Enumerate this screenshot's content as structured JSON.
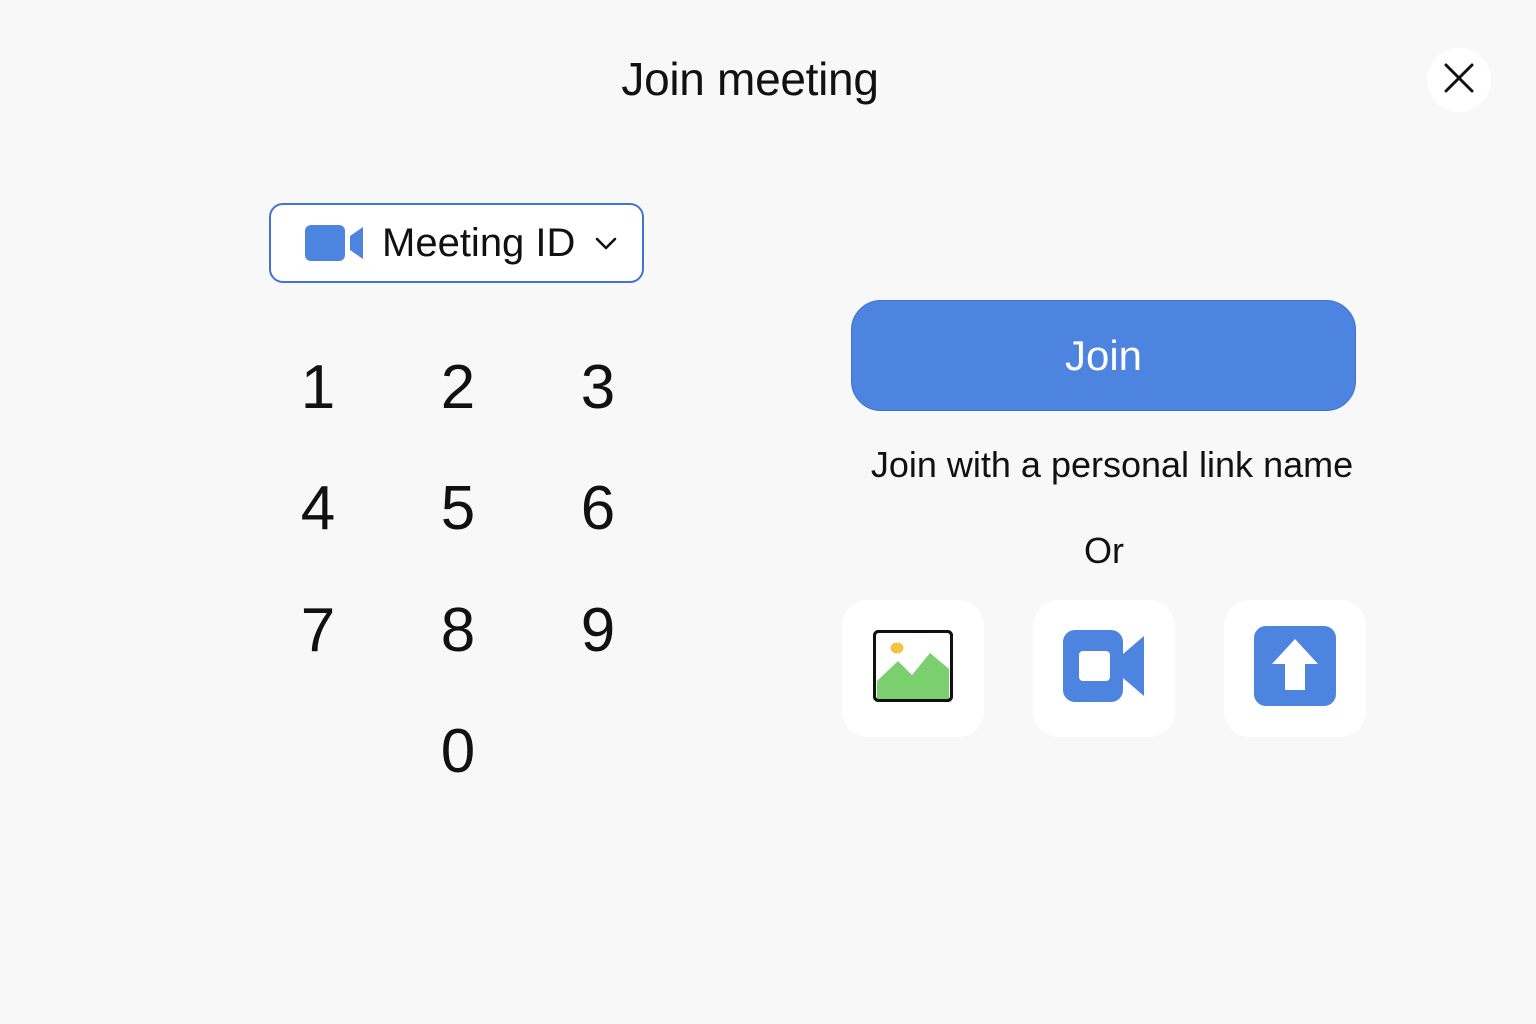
{
  "dialog": {
    "title": "Join meeting",
    "close_icon": "close-icon"
  },
  "id_selector": {
    "icon": "video-camera-icon",
    "label": "Meeting ID",
    "dropdown_icon": "chevron-down-icon"
  },
  "keypad": {
    "keys": [
      "1",
      "2",
      "3",
      "4",
      "5",
      "6",
      "7",
      "8",
      "9",
      "0"
    ]
  },
  "join_button": {
    "label": "Join"
  },
  "personal_link": {
    "label": "Join with a personal link name"
  },
  "divider": {
    "label": "Or"
  },
  "join_options": [
    {
      "icon": "image-icon"
    },
    {
      "icon": "video-camera-icon"
    },
    {
      "icon": "upload-icon"
    }
  ],
  "colors": {
    "accent": "#4d84e0",
    "background": "#f8f8f8",
    "image_icon_green": "#7ccf6e",
    "image_icon_sun": "#f5c242"
  }
}
